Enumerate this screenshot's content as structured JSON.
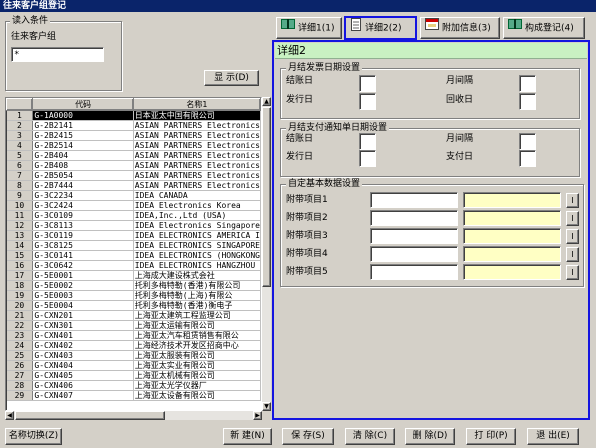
{
  "window": {
    "title": "往来客户组登记"
  },
  "search": {
    "group_title": "读入条件",
    "field_label": "往来客户组",
    "field_value": "*",
    "show_button": "显 示(D)"
  },
  "grid": {
    "columns": [
      "",
      "代码",
      "名称1"
    ],
    "rows": [
      {
        "num": "1",
        "code": "G-1A0000",
        "name": "日本亚太中国有限公司"
      },
      {
        "num": "2",
        "code": "G-2B2141",
        "name": "ASIAN PARTNERS Electronics"
      },
      {
        "num": "3",
        "code": "G-2B2415",
        "name": "ASIAN PARTNERS Electronics"
      },
      {
        "num": "4",
        "code": "G-2B2514",
        "name": "ASIAN PARTNERS Electronics"
      },
      {
        "num": "5",
        "code": "G-2B404",
        "name": "ASIAN PARTNERS Electronics"
      },
      {
        "num": "6",
        "code": "G-2B408",
        "name": "ASIAN PARTNERS Electronics"
      },
      {
        "num": "7",
        "code": "G-2B5054",
        "name": "ASIAN PARTNERS Electronics"
      },
      {
        "num": "8",
        "code": "G-2B7444",
        "name": "ASIAN PARTNERS Electronics"
      },
      {
        "num": "9",
        "code": "G-3C2234",
        "name": "IDEA CANADA"
      },
      {
        "num": "10",
        "code": "G-3C2424",
        "name": "IDEA Electronics Korea"
      },
      {
        "num": "11",
        "code": "G-3C0109",
        "name": "IDEA,Inc.,Ltd (USA)"
      },
      {
        "num": "12",
        "code": "G-3C8113",
        "name": "IDEA Electronics Singapore"
      },
      {
        "num": "13",
        "code": "G-3C0119",
        "name": "IDEA ELECTRONICS AMERICA I"
      },
      {
        "num": "14",
        "code": "G-3C8125",
        "name": "IDEA ELECTRONICS SINGAPORE"
      },
      {
        "num": "15",
        "code": "G-3C0141",
        "name": "IDEA ELECTRONICS (HONGKONG"
      },
      {
        "num": "16",
        "code": "G-3C0642",
        "name": "IDEA ELECTRONICS HANGZHOU"
      },
      {
        "num": "17",
        "code": "G-5E0001",
        "name": "上海成大建设株式会社"
      },
      {
        "num": "18",
        "code": "G-5E0002",
        "name": "托利多梅特勒(香港)有限公司"
      },
      {
        "num": "19",
        "code": "G-5E0003",
        "name": "托利多梅特勒(上海)有限公"
      },
      {
        "num": "20",
        "code": "G-5E0004",
        "name": "托利多梅特勒(香港)衡电子"
      },
      {
        "num": "21",
        "code": "G-CXN201",
        "name": "上海亚太建筑工程监理公司"
      },
      {
        "num": "22",
        "code": "G-CXN301",
        "name": "上海亚太运输有限公司"
      },
      {
        "num": "23",
        "code": "G-CXN401",
        "name": "上海亚太汽车租赁销售有限公"
      },
      {
        "num": "24",
        "code": "G-CXN402",
        "name": "上海经济技术开发区招商中心"
      },
      {
        "num": "25",
        "code": "G-CXN403",
        "name": "上海亚太服装有限公司"
      },
      {
        "num": "26",
        "code": "G-CXN404",
        "name": "上海亚太实业有限公司"
      },
      {
        "num": "27",
        "code": "G-CXN405",
        "name": "上海亚太机械有限公司"
      },
      {
        "num": "28",
        "code": "G-CXN406",
        "name": "上海亚太光学仪器厂"
      },
      {
        "num": "29",
        "code": "G-CXN407",
        "name": "上海亚太设备有限公司"
      }
    ]
  },
  "tabs": [
    {
      "label": "详细1(1)",
      "icon": "book-icon",
      "active": false
    },
    {
      "label": "详细2(2)",
      "icon": "document-icon",
      "active": true
    },
    {
      "label": "附加信息(3)",
      "icon": "window-icon",
      "active": false
    },
    {
      "label": "构成登记(4)",
      "icon": "book-icon",
      "active": false
    }
  ],
  "panel": {
    "header": "详细2",
    "invoice_group": {
      "title": "月结发票日期设置",
      "closing_day": "结账日",
      "interval": "月间隔",
      "issue_day": "发行日",
      "collect_day": "回收日"
    },
    "payment_group": {
      "title": "月结支付通知单日期设置",
      "closing_day": "结账日",
      "interval": "月间隔",
      "issue_day": "发行日",
      "pay_day": "支付日"
    },
    "custom_group": {
      "title": "自定基本数据设置",
      "items": [
        "附带项目1",
        "附带项目2",
        "附带项目3",
        "附带项目4",
        "附带项目5"
      ],
      "pick_label": "I"
    }
  },
  "toolbar": {
    "name_switch": "名称切换(Z)",
    "new": "新 建(N)",
    "save": "保 存(S)",
    "clear": "清 除(C)",
    "delete": "删 除(D)",
    "print": "打 印(P)",
    "exit": "退 出(E)"
  },
  "colors": {
    "active_tab_border": "#1414e0",
    "panel_header": "#c9f1c2",
    "yellow_field": "#ffffc4",
    "title_bar": "#0a246a"
  }
}
